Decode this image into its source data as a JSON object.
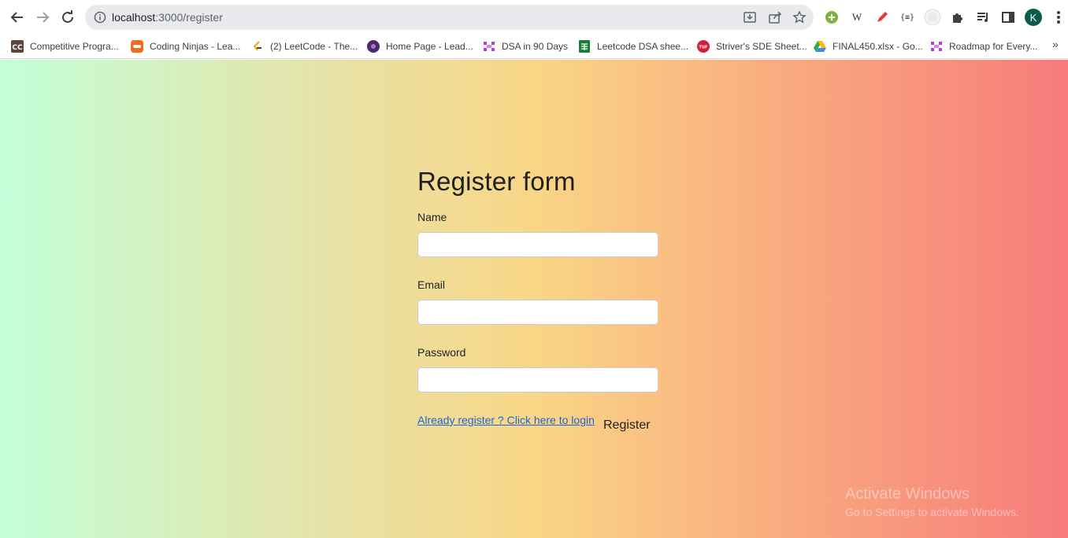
{
  "browser": {
    "url_host": "localhost",
    "url_path": ":3000/register",
    "avatar_letter": "K",
    "bookmarks": [
      {
        "label": "Competitive Progra...",
        "icon": "codechef-icon",
        "color": "#5b4638"
      },
      {
        "label": "Coding Ninjas - Lea...",
        "icon": "coding-ninjas-icon",
        "color": "#f26a21"
      },
      {
        "label": "(2) LeetCode - The...",
        "icon": "leetcode-icon",
        "color": "#f89f1b"
      },
      {
        "label": "Home Page - Lead...",
        "icon": "home-page-icon",
        "color": "#4a2a6b"
      },
      {
        "label": "DSA in 90 Days",
        "icon": "dsa-icon",
        "color": "#b73cd8"
      },
      {
        "label": "Leetcode DSA shee...",
        "icon": "sheets-icon",
        "color": "#188038"
      },
      {
        "label": "Striver's SDE Sheet...",
        "icon": "tuf-icon",
        "color": "#d21f3c"
      },
      {
        "label": "FINAL450.xlsx - Go...",
        "icon": "google-drive-icon",
        "color": "#1a73e8"
      },
      {
        "label": "Roadmap for Every...",
        "icon": "roadmap-icon",
        "color": "#b73cd8"
      }
    ],
    "more_bookmarks": "»"
  },
  "form": {
    "title": "Register form",
    "name_label": "Name",
    "name_value": "",
    "email_label": "Email",
    "email_value": "",
    "password_label": "Password",
    "password_value": "",
    "login_link": "Already register ? Click here to login",
    "register_button": "Register"
  },
  "watermark": {
    "line1": "Activate Windows",
    "line2": "Go to Settings to activate Windows."
  },
  "colors": {
    "gradient_start": "#c3ffd9",
    "gradient_mid": "#f9d686",
    "gradient_end": "#f77b7b",
    "link": "#1a66d8"
  }
}
